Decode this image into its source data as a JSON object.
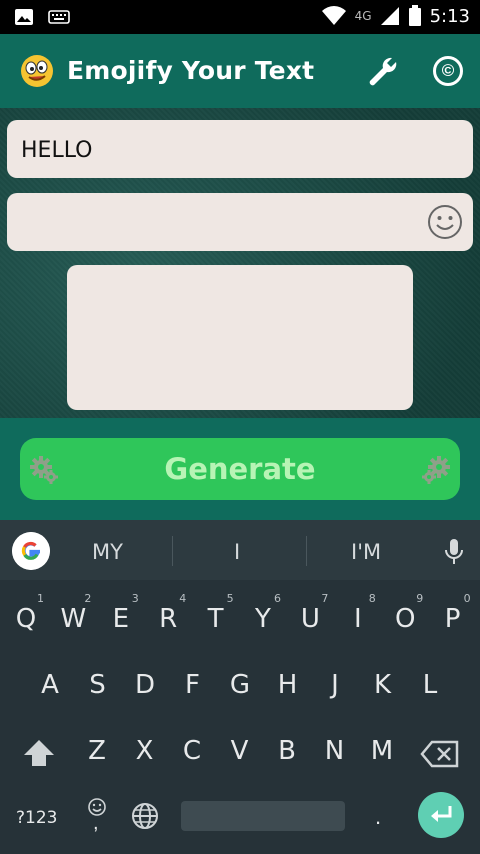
{
  "status_bar": {
    "network": "4G",
    "time": "5:13"
  },
  "app_bar": {
    "title": "Emojify Your Text",
    "settings_icon": "wrench-icon",
    "about_icon": "copyright-icon",
    "about_glyph": "©"
  },
  "main": {
    "input_text": "HELLO",
    "emoji_field_value": "",
    "output_value": "",
    "generate_label": "Generate"
  },
  "keyboard": {
    "suggestions": [
      "MY",
      "I",
      "I'M"
    ],
    "row1": [
      {
        "k": "Q",
        "n": "1"
      },
      {
        "k": "W",
        "n": "2"
      },
      {
        "k": "E",
        "n": "3"
      },
      {
        "k": "R",
        "n": "4"
      },
      {
        "k": "T",
        "n": "5"
      },
      {
        "k": "Y",
        "n": "6"
      },
      {
        "k": "U",
        "n": "7"
      },
      {
        "k": "I",
        "n": "8"
      },
      {
        "k": "O",
        "n": "9"
      },
      {
        "k": "P",
        "n": "0"
      }
    ],
    "row2": [
      "A",
      "S",
      "D",
      "F",
      "G",
      "H",
      "J",
      "K",
      "L"
    ],
    "row3": [
      "Z",
      "X",
      "C",
      "V",
      "B",
      "N",
      "M"
    ],
    "numbers_key": "?123",
    "comma": ",",
    "period": "."
  },
  "colors": {
    "app_bar": "#0f6b5c",
    "button": "#2fc65a",
    "button_text": "#b7f4b5",
    "field": "#efe7e3",
    "keyboard_bg": "#263238",
    "enter": "#5fcfb3"
  }
}
